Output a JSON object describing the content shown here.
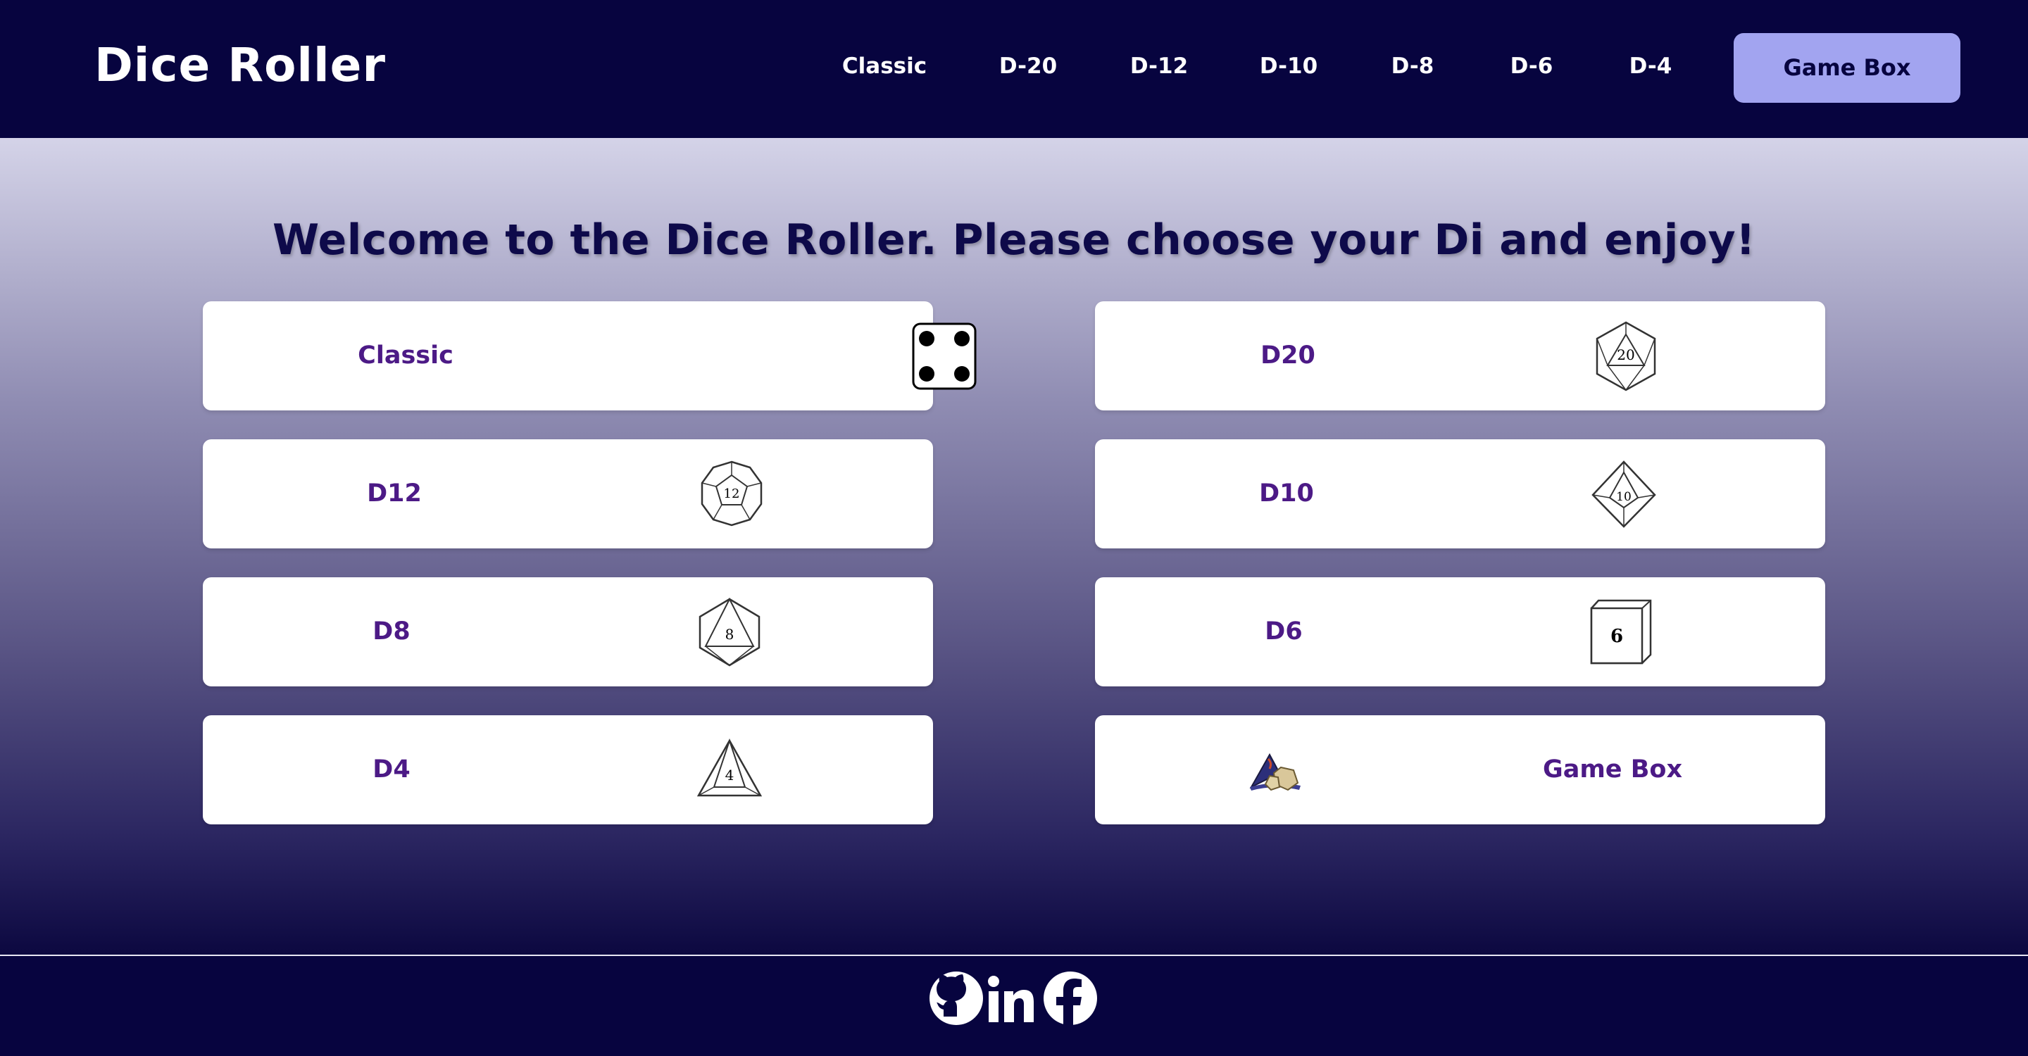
{
  "header": {
    "brand": "Dice Roller",
    "nav": [
      "Classic",
      "D-20",
      "D-12",
      "D-10",
      "D-8",
      "D-6",
      "D-4"
    ],
    "cta": "Game Box"
  },
  "main": {
    "welcome": "Welcome to the Dice Roller. Please choose your Di and enjoy!",
    "cards": [
      {
        "label": "Classic",
        "icon": "classic-die-icon"
      },
      {
        "label": "D20",
        "icon": "d20-die-icon",
        "die_number": "20"
      },
      {
        "label": "D12",
        "icon": "d12-die-icon",
        "die_number": "12"
      },
      {
        "label": "D10",
        "icon": "d10-die-icon",
        "die_number": "10"
      },
      {
        "label": "D8",
        "icon": "d8-die-icon",
        "die_number": "8"
      },
      {
        "label": "D6",
        "icon": "d6-die-icon",
        "die_number": "6"
      },
      {
        "label": "D4",
        "icon": "d4-die-icon",
        "die_number": "4"
      },
      {
        "label": "Game Box",
        "icon": "wizard-hat-dice-icon"
      }
    ]
  },
  "footer": {
    "icons": [
      "github-icon",
      "linkedin-icon",
      "facebook-icon"
    ]
  },
  "colors": {
    "navy": "#07043f",
    "accent": "#a2a4f0",
    "card_text": "#4c1a86",
    "heading": "#0e0a4a"
  }
}
